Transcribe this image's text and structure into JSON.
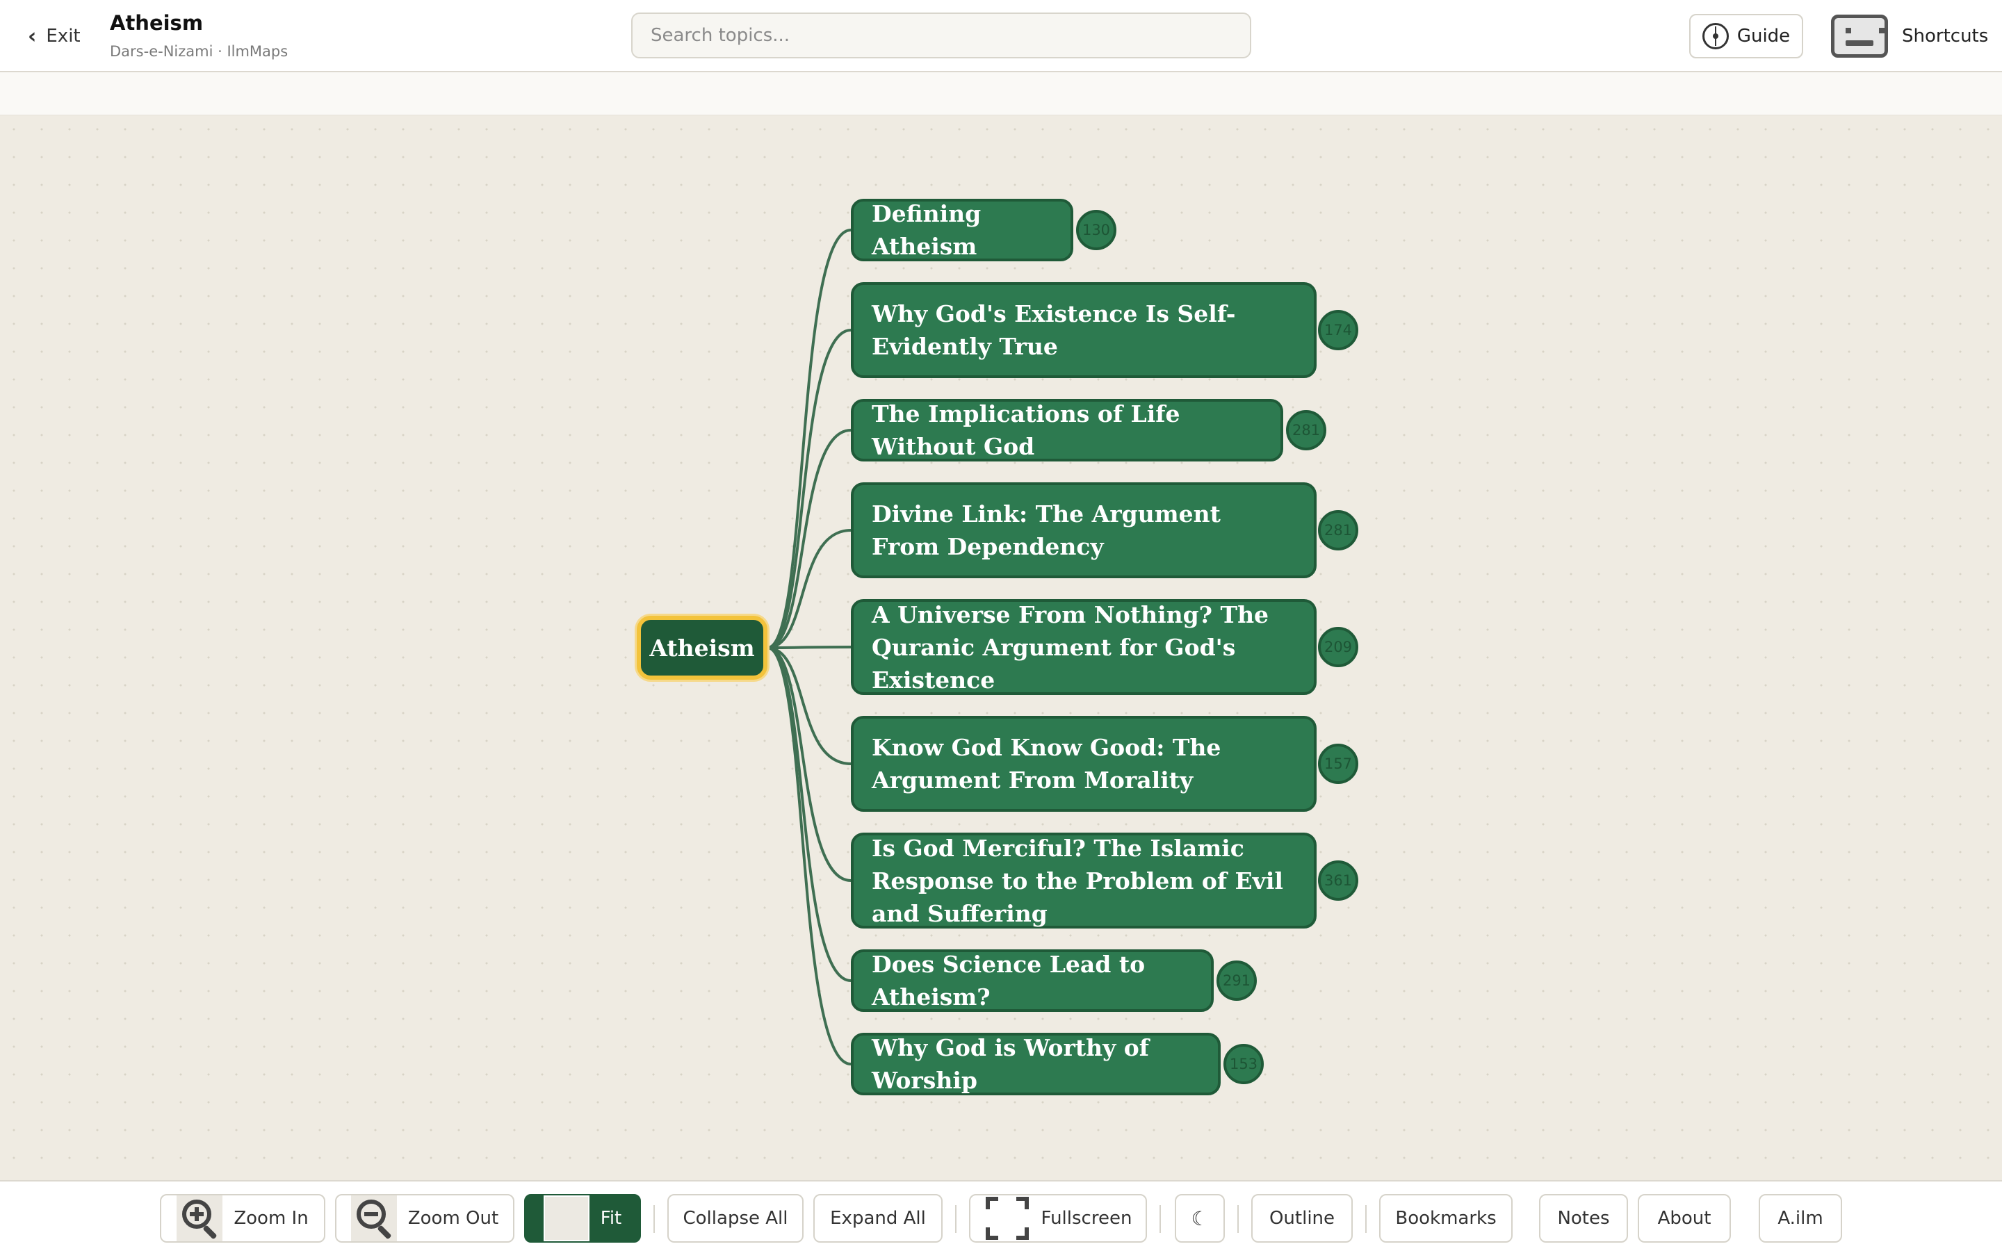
{
  "header": {
    "exit_label": "Exit",
    "title": "Atheism",
    "subtitle": "Dars-e-Nizami · IlmMaps",
    "search_placeholder": "Search topics...",
    "guide_label": "Guide",
    "shortcuts_label": "Shortcuts"
  },
  "mindmap": {
    "root": "Atheism",
    "children": [
      {
        "label": "Defining Atheism",
        "badge": "130"
      },
      {
        "label": "Why God's Existence Is Self-Evidently True",
        "badge": "174"
      },
      {
        "label": "The Implications of Life Without God",
        "badge": "281"
      },
      {
        "label": "Divine Link: The Argument From Dependency",
        "badge": "281"
      },
      {
        "label": "A Universe From Nothing? The Quranic Argument for God's Existence",
        "badge": "209"
      },
      {
        "label": "Know God Know Good: The Argument From Morality",
        "badge": "157"
      },
      {
        "label": "Is God Merciful? The Islamic Response to the Problem of Evil and Suffering",
        "badge": "361"
      },
      {
        "label": "Does Science Lead to Atheism?",
        "badge": "291"
      },
      {
        "label": "Why God is Worthy of Worship",
        "badge": "153"
      }
    ]
  },
  "toolbar": {
    "zoom_in": "Zoom In",
    "zoom_out": "Zoom Out",
    "fit": "Fit",
    "collapse_all": "Collapse All",
    "expand_all": "Expand All",
    "fullscreen": "Fullscreen",
    "theme_glyph": "☾",
    "outline": "Outline",
    "bookmarks": "Bookmarks",
    "notes": "Notes",
    "about": "About",
    "ailm": "A.ilm"
  },
  "colors": {
    "node_fill": "#2d7a50",
    "node_border": "#1f5a38",
    "root_border": "#f3c33b",
    "canvas": "#efebe2",
    "edge": "#3f6f52"
  },
  "icons": [
    "chevron-left-icon",
    "guide-icon",
    "keyboard-icon",
    "zoom-in-icon",
    "zoom-out-icon",
    "fit-icon",
    "fullscreen-icon",
    "moon-icon"
  ]
}
